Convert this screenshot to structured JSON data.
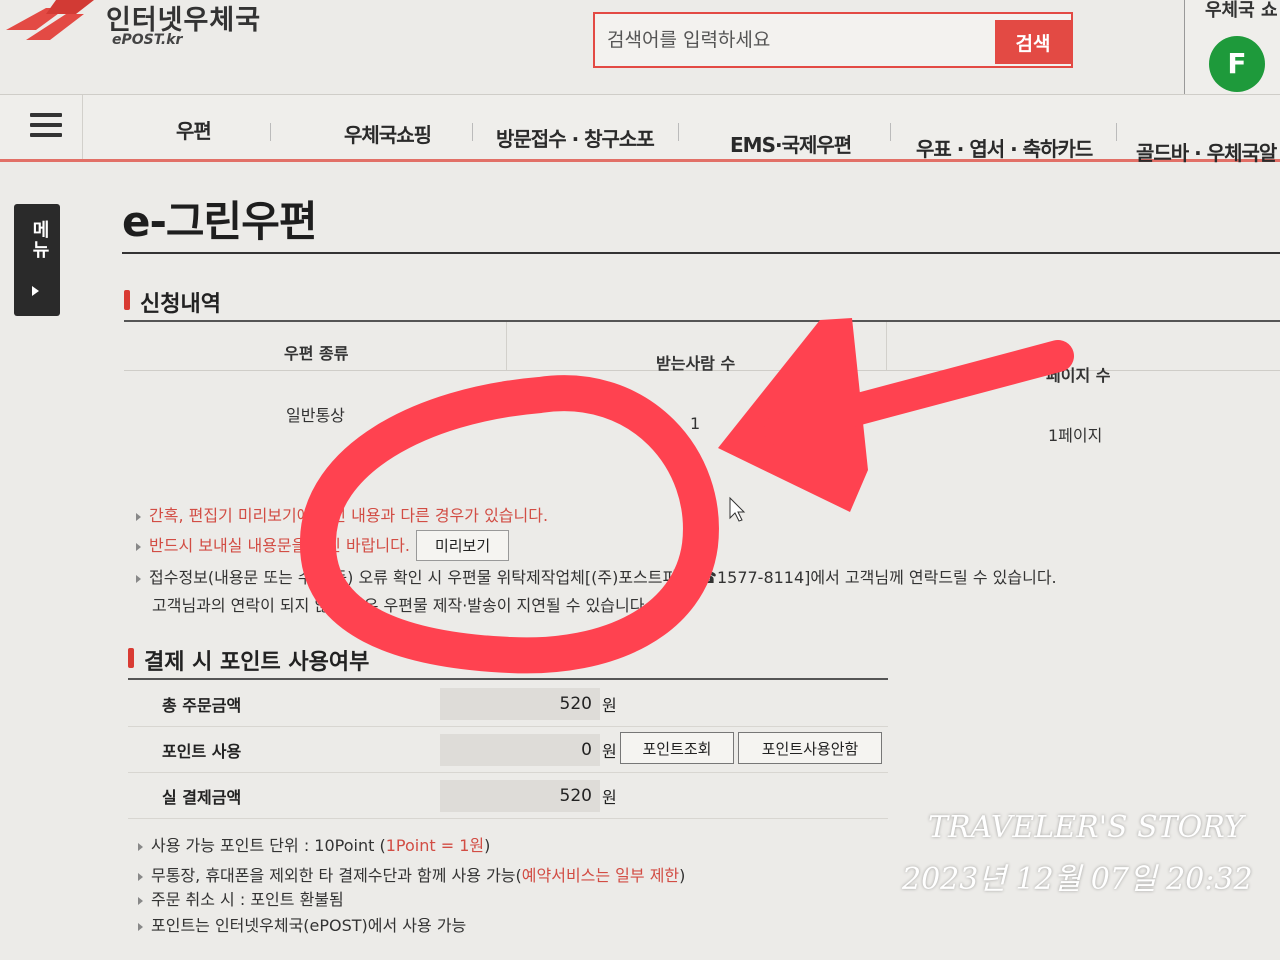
{
  "header": {
    "logo_title": "인터넷우체국",
    "logo_sub": "ePOST.kr",
    "search_placeholder": "검색어를 입력하세요",
    "search_button": "검색",
    "side_title": "우체국 쇼",
    "side_avatar_letter": "F"
  },
  "nav": {
    "items": [
      "우편",
      "우체국쇼핑",
      "방문접수 · 창구소포",
      "EMS·국제우편",
      "우표 · 엽서 · 축하카드",
      "골드바 · 우체국알"
    ]
  },
  "side_menu": {
    "label": "메뉴"
  },
  "page": {
    "title": "e-그린우편"
  },
  "application": {
    "section_title": "신청내역",
    "columns": [
      "우편 종류",
      "받는사람 수",
      "페이지 수"
    ],
    "rows": [
      {
        "type": "일반통상",
        "recipients": "1",
        "pages": "1페이지"
      }
    ]
  },
  "notices": {
    "line1": "간혹, 편집기 미리보기에 수신 내용과 다른 경우가 있습니다.",
    "line2": "반드시 보내실 내용문을 확인 바랍니다.",
    "preview_button": "미리보기",
    "line3": "접수정보(내용문 또는 수신 등) 오류 확인 시 우편물 위탁제작업체[(주)포스트피아 ☎1577-8114]에서 고객님께 연락드릴 수 있습니다.",
    "line4": "고객님과의 연락이 되지 않을 경우 우편물 제작·발송이 지연될 수 있습니다."
  },
  "payment": {
    "section_title": "결제 시 포인트 사용여부",
    "rows": [
      {
        "label": "총 주문금액",
        "value": "520",
        "unit": "원"
      },
      {
        "label": "포인트 사용",
        "value": "0",
        "unit": "원"
      },
      {
        "label": "실 결제금액",
        "value": "520",
        "unit": "원"
      }
    ],
    "point_lookup_button": "포인트조회",
    "point_no_use_button": "포인트사용안함"
  },
  "point_notes": {
    "line1_prefix": "사용 가능 포인트 단위 : 10Point (",
    "line1_red": "1Point = 1원",
    "line1_suffix": ")",
    "line2_prefix": "무통장, 휴대폰을 제외한 타 결제수단과 함께 사용 가능(",
    "line2_red": "예약서비스는 일부 제한",
    "line2_suffix": ")",
    "line3": "주문 취소 시 : 포인트 환불됨",
    "line4": "포인트는 인터넷우체국(ePOST)에서 사용 가능"
  },
  "watermark": {
    "line1": "TRAVELER'S STORY",
    "line2": "2023년 12월 07일 20:32"
  },
  "colors": {
    "brand_red": "#e34a44",
    "annotation_red": "#ff4250",
    "green": "#1e9a3b"
  }
}
